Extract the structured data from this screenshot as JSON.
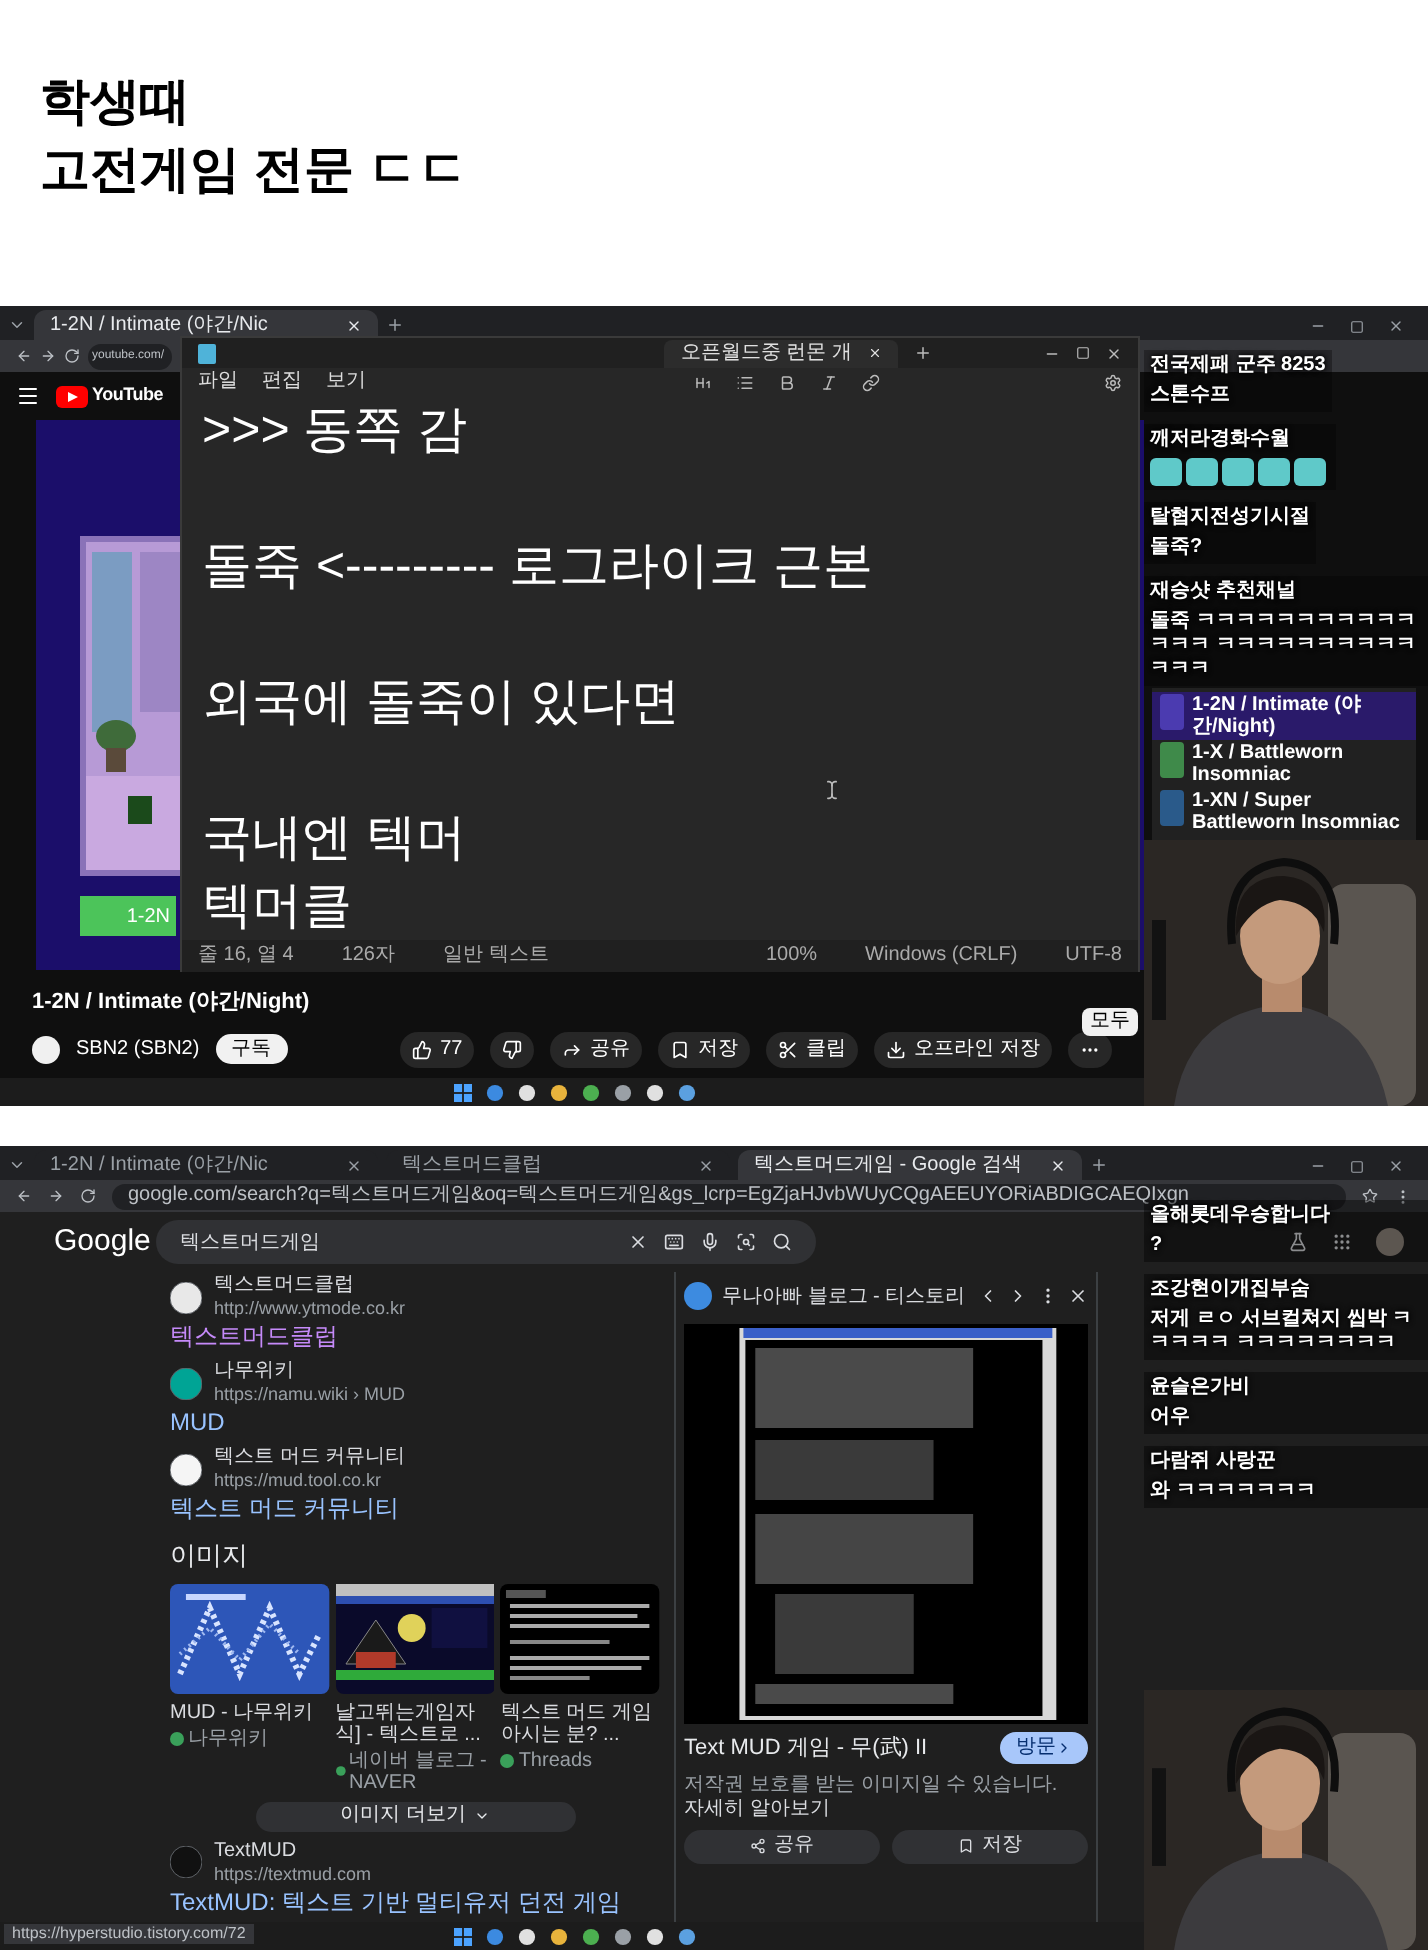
{
  "post": {
    "title_lines": [
      "학생때",
      "고전게임 전문 ㄷㄷ"
    ]
  },
  "shot1": {
    "tabs": [
      {
        "label": "1-2N / Intimate (야간/Nic",
        "selected": true
      }
    ],
    "address": "youtube.com/",
    "logo": "YouTube",
    "video_button": "1-2N",
    "notepad": {
      "tabs": [
        {
          "label": "오픈월드중 런몬 개",
          "selected": true
        }
      ],
      "menu": [
        "파일",
        "편집",
        "보기"
      ],
      "blocks": [
        [
          ">>> 동쪽 감"
        ],
        [
          "돌죽 <--------- 로그라이크 근본"
        ],
        [
          "외국에 돌죽이 있다면"
        ],
        [
          "국내엔 텍머",
          "텍머클"
        ]
      ],
      "status": [
        "줄 16, 열 4",
        "126자",
        "일반 텍스트",
        "100%",
        "Windows (CRLF)",
        "UTF-8"
      ]
    },
    "video_title": "1-2N / Intimate (야간/Night)",
    "channel": "SBN2 (SBN2)",
    "subscribe": "구독",
    "actions": [
      {
        "kind": "like",
        "label": "77"
      },
      {
        "kind": "dislike"
      },
      {
        "kind": "share",
        "label": "공유"
      },
      {
        "kind": "save",
        "label": "저장"
      },
      {
        "kind": "clip",
        "label": "클립"
      },
      {
        "kind": "download",
        "label": "오프라인 저장"
      },
      {
        "kind": "more"
      }
    ],
    "chip": {
      "label": "모두",
      "selected": true
    },
    "playlist": [
      {
        "title": "1-2N / Intimate (야간/Night)",
        "color": "#4b3bb0",
        "selected": true
      },
      {
        "title": "1-X / Battleworn Insomniac",
        "color": "#3f8a4a",
        "selected": false
      },
      {
        "title": "1-XN / Super Battleworn Insomniac",
        "color": "#2a5a8a",
        "selected": false
      }
    ],
    "chat": [
      {
        "kind": "text",
        "name": "전국제패 군주 8253",
        "text": "스톤수프"
      },
      {
        "kind": "emotes",
        "name": "깨저라경화수월"
      },
      {
        "kind": "text",
        "name": "탈협지전성기시절",
        "text": "돌죽?"
      },
      {
        "kind": "text",
        "name": "재승샷 추천채널",
        "text": "돌죽 ㅋㅋㅋㅋㅋㅋㅋㅋㅋㅋㅋㅋㅋㅋ ㅋㅋㅋㅋㅋㅋㅋㅋㅋㅋㅋㅋㅋ"
      }
    ]
  },
  "shot2": {
    "tabs": [
      {
        "label": "1-2N / Intimate (야간/Nic",
        "selected": false
      },
      {
        "label": "텍스트머드클럽",
        "selected": false
      },
      {
        "label": "텍스트머드게임 - Google 검색",
        "selected": true
      }
    ],
    "address": "google.com/search?q=텍스트머드게임&oq=텍스트머드게임&gs_lcrp=EgZjaHJvbWUyCQgAEEUYORiABDIGCAEQIxgn",
    "logo": "Google",
    "query": "텍스트머드게임",
    "results": [
      {
        "site": "텍스트머드클럽",
        "url": "http://www.ytmode.co.kr",
        "title": "텍스트머드클럽",
        "visited": true
      },
      {
        "site": "나무위키",
        "url": "https://namu.wiki › MUD",
        "title": "MUD",
        "visited": false
      },
      {
        "site": "텍스트 머드 커뮤니티",
        "url": "https://mud.tool.co.kr",
        "title": "텍스트 머드 커뮤니티",
        "visited": false
      }
    ],
    "images": {
      "heading": "이미지",
      "more": "이미지 더보기",
      "items": [
        {
          "kind": "pattern",
          "caption": "MUD - 나무위키",
          "source": "나무위키"
        },
        {
          "kind": "night",
          "caption": "날고뛰는게임자식] - 텍스트로 ...",
          "source": "네이버 블로그 - NAVER"
        },
        {
          "kind": "terminal",
          "caption": "텍스트 머드 게임 아시는 분? ...",
          "source": "Threads"
        }
      ]
    },
    "last_result": {
      "site": "TextMUD",
      "url": "https://textmud.com",
      "title": "TextMUD: 텍스트 기반 멀티유저 던전 게임",
      "visited": false
    },
    "preview": {
      "site": "무나아빠 블로그 - 티스토리",
      "title": "Text MUD 게임 - 무(武) II",
      "visit": "방문",
      "notice": "저작권 보호를 받는 이미지일 수 있습니다.",
      "notice_link": "자세히 알아보기",
      "buttons": [
        {
          "kind": "share",
          "label": "공유"
        },
        {
          "kind": "save",
          "label": "저장"
        }
      ]
    },
    "status_url": "https://hyperstudio.tistory.com/72",
    "chat": [
      {
        "kind": "text",
        "name": "올해롯데우승합니다",
        "text": "?"
      },
      {
        "kind": "text",
        "name": "조강현이개집부숨",
        "text": "저게 ㄹㅇ 서브컬쳐지 씹박 ㅋㅋㅋㅋㅋ ㅋㅋㅋㅋㅋㅋㅋㅋ"
      },
      {
        "kind": "text",
        "name": "윤슬은가비",
        "text": "어우"
      },
      {
        "kind": "text",
        "name": "다람쥐 사랑꾼",
        "text": "와 ㅋㅋㅋㅋㅋㅋㅋ"
      }
    ]
  }
}
